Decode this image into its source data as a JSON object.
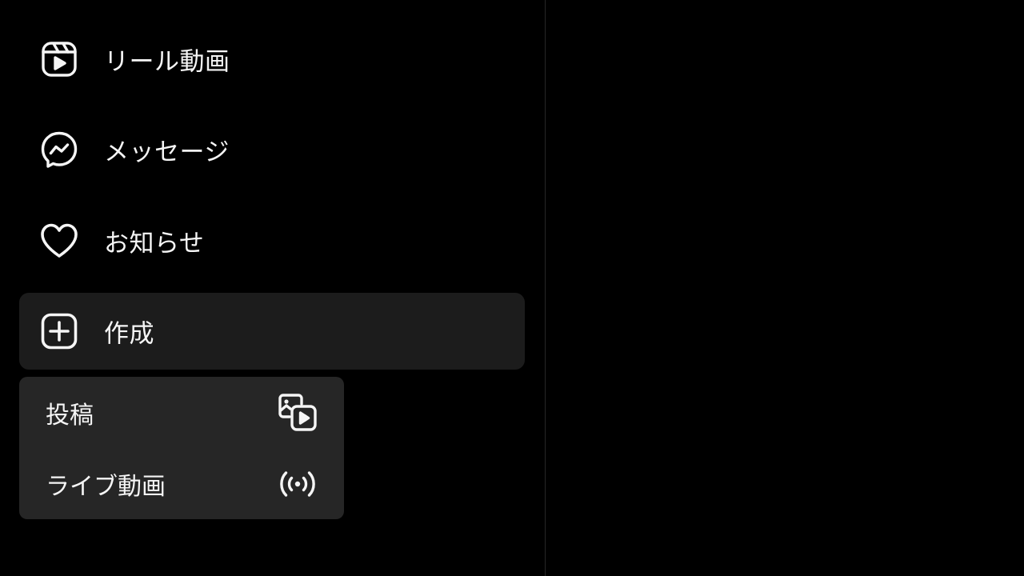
{
  "sidebar": {
    "items": [
      {
        "label": "リール動画",
        "icon": "reels-icon"
      },
      {
        "label": "メッセージ",
        "icon": "messenger-icon"
      },
      {
        "label": "お知らせ",
        "icon": "heart-icon"
      },
      {
        "label": "作成",
        "icon": "create-plus-icon",
        "active": true
      }
    ]
  },
  "create_menu": {
    "items": [
      {
        "label": "投稿",
        "icon": "post-media-icon"
      },
      {
        "label": "ライブ動画",
        "icon": "live-broadcast-icon"
      }
    ]
  },
  "colors": {
    "background": "#000000",
    "active_item_bg": "#1c1c1c",
    "submenu_bg": "#262626",
    "text": "#f5f5f5",
    "divider": "#262626"
  }
}
